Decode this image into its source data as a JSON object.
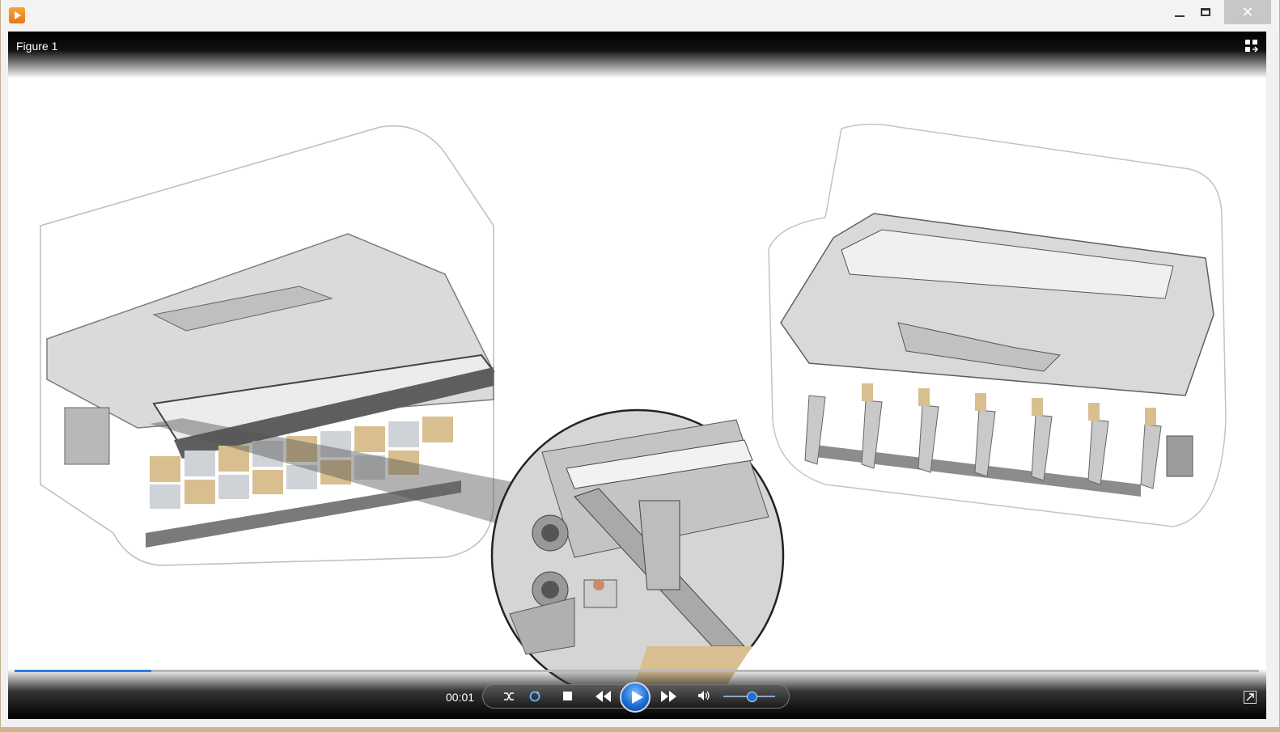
{
  "window": {
    "app_icon": "media-player-icon",
    "buttons": [
      "minimize",
      "maximize",
      "close"
    ],
    "close_glyph": "✕"
  },
  "video": {
    "title": "Figure 1",
    "view_icon": "switch-to-library-icon"
  },
  "controls": {
    "time": "00:01",
    "progress_fraction": 0.11,
    "volume_fraction": 0.55,
    "icons": [
      "shuffle-icon",
      "repeat-icon",
      "stop-icon",
      "previous-icon",
      "play-icon",
      "next-icon",
      "volume-icon",
      "fullscreen-icon"
    ]
  },
  "colors": {
    "accent": "#2a7fe0",
    "play": "#1c6fd6",
    "cardboard": "#d9bf8f"
  }
}
